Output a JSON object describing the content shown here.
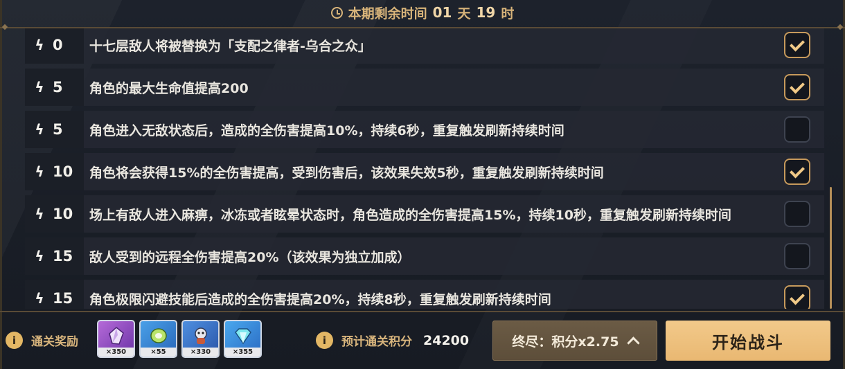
{
  "header": {
    "label": "本期剩余时间",
    "days": "01",
    "days_unit": "天",
    "hours": "19",
    "hours_unit": "时"
  },
  "modifiers": [
    {
      "cost": "0",
      "text": "十七层敌人将被替换为「支配之律者-乌合之众」",
      "checked": true
    },
    {
      "cost": "5",
      "text": "角色的最大生命值提高200",
      "checked": true
    },
    {
      "cost": "5",
      "text": "角色进入无敌状态后，造成的全伤害提高10%，持续6秒，重复触发刷新持续时间",
      "checked": false
    },
    {
      "cost": "10",
      "text": "角色将会获得15%的全伤害提高，受到伤害后，该效果失效5秒，重复触发刷新持续时间",
      "checked": true
    },
    {
      "cost": "10",
      "text": "场上有敌人进入麻痹，冰冻或者眩晕状态时，角色造成的全伤害提高15%，持续10秒，重复触发刷新持续时间",
      "checked": false
    },
    {
      "cost": "15",
      "text": "敌人受到的远程全伤害提高20%（该效果为独立加成）",
      "checked": false
    },
    {
      "cost": "15",
      "text": "角色极限闪避技能后造成的全伤害提高20%，持续8秒，重复触发刷新持续时间",
      "checked": true
    }
  ],
  "rewards": {
    "label": "通关奖励",
    "items": [
      {
        "count": "×350",
        "icon": "crystal-shard-icon"
      },
      {
        "count": "×55",
        "icon": "chip-icon"
      },
      {
        "count": "×330",
        "icon": "creature-icon"
      },
      {
        "count": "×355",
        "icon": "diamond-icon"
      }
    ]
  },
  "score": {
    "label": "预计通关积分",
    "value": "24200"
  },
  "difficulty_button": "终尽：积分x2.75",
  "start_button": "开始战斗",
  "colors": {
    "accent": "#d8b47a",
    "button": "#f2c98a"
  }
}
